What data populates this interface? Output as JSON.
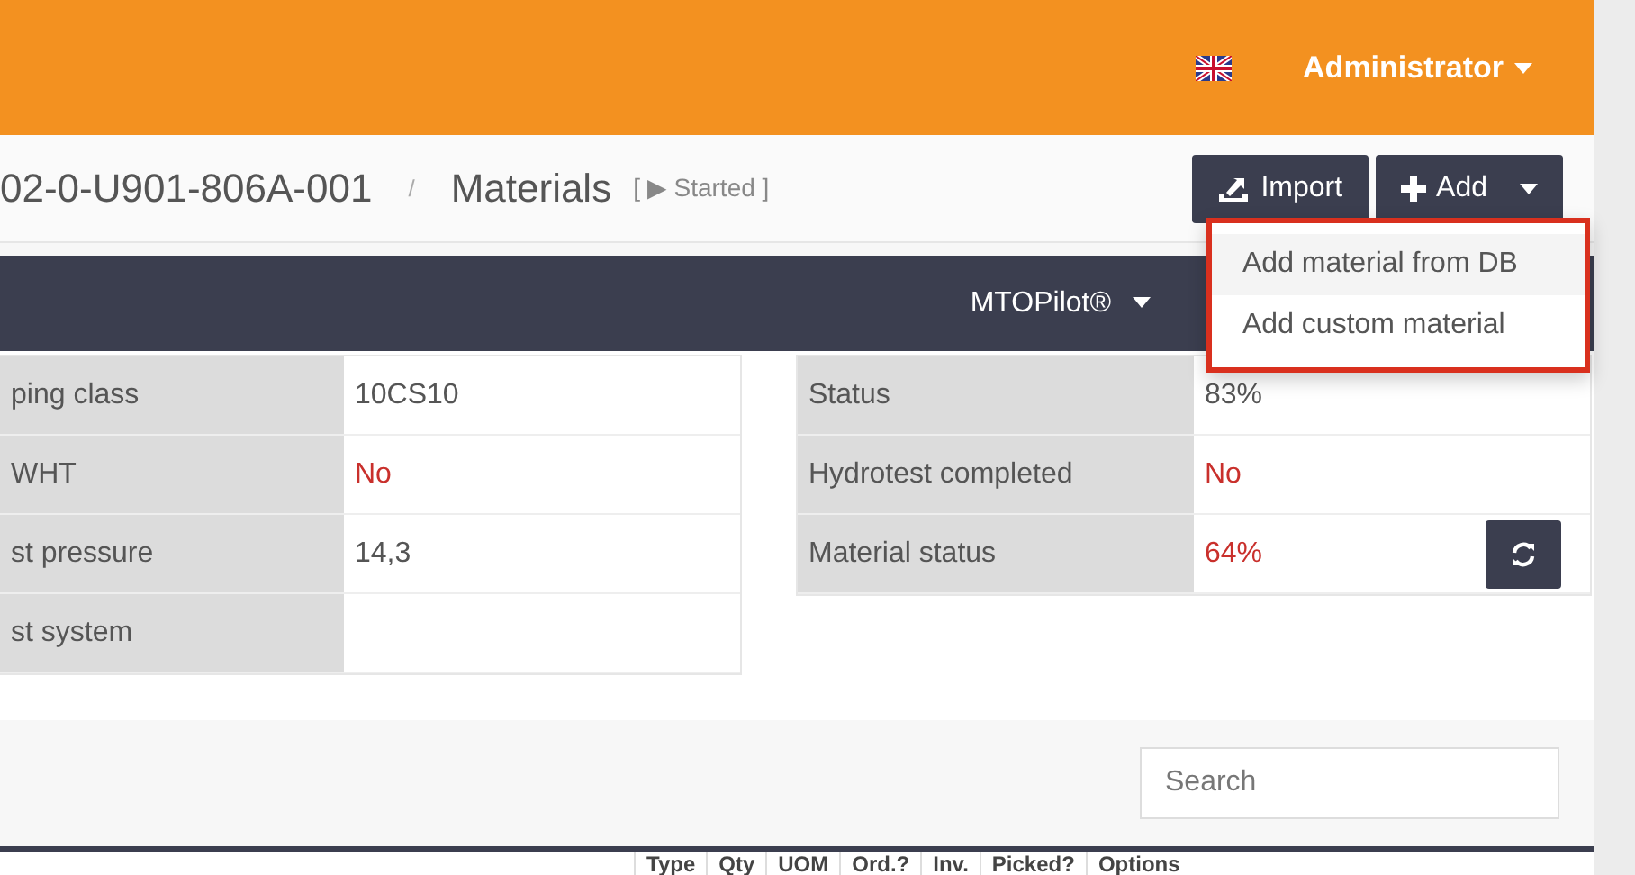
{
  "navbar": {
    "user": "Administrator"
  },
  "breadcrumb": {
    "parent": "02-0-U901-806A-001",
    "separator": "/",
    "title": "Materials",
    "status": "[ ▶ Started ]"
  },
  "actions": {
    "import": "Import",
    "add": "Add",
    "add_expanded": true,
    "menu": [
      {
        "label": "Add material from DB",
        "highlighted": true
      },
      {
        "label": "Add custom material",
        "highlighted": false
      }
    ]
  },
  "panel": {
    "menu": "MTOPilot®"
  },
  "left_table": [
    {
      "label": "ping class",
      "value": "10CS10",
      "alert": false
    },
    {
      "label": "WHT",
      "value": "No",
      "alert": true
    },
    {
      "label": "st pressure",
      "value": "14,3",
      "alert": false
    },
    {
      "label": "st system"
    }
  ],
  "right_table": [
    {
      "label": "Status",
      "value": "83%",
      "alert": false,
      "refresh": false
    },
    {
      "label": "Hydrotest completed",
      "value": "No",
      "alert": true,
      "refresh": false
    },
    {
      "label": "Material status",
      "value": "64%",
      "alert": true,
      "refresh": true
    }
  ],
  "search": {
    "placeholder": "Search"
  },
  "columns": [
    "Type",
    "Qty",
    "UOM",
    "Ord.?",
    "Inv.",
    "Picked?",
    "Options"
  ]
}
